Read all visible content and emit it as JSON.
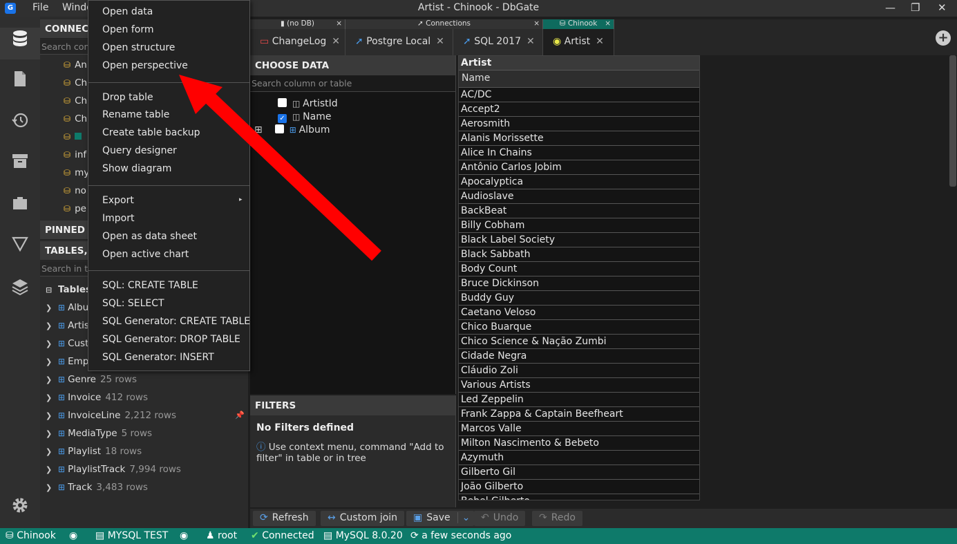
{
  "titlebar": {
    "title": "Artist - Chinook - DbGate",
    "app_icon": "G",
    "menus": [
      "File",
      "Window"
    ]
  },
  "sidebar": {
    "icons": [
      "database-icon",
      "file-icon",
      "history-icon",
      "archive-icon",
      "plugin-icon",
      "filter-icon",
      "layers-icon",
      "settings-icon"
    ]
  },
  "left_panel": {
    "connections_header": "CONNECT",
    "connections_search_placeholder": "Search con",
    "connections": [
      "An",
      "Ch",
      "Ch",
      "Ch",
      "",
      "inf",
      "my",
      "no",
      "pe"
    ],
    "pinned_header": "PINNED",
    "tables_header": "TABLES, V",
    "tables_search_placeholder": "Search in t",
    "tables_group": "Tables",
    "tables": [
      {
        "name": "Albu",
        "rows": ""
      },
      {
        "name": "Artis",
        "rows": ""
      },
      {
        "name": "Cust",
        "rows": ""
      },
      {
        "name": "Emp",
        "rows": ""
      },
      {
        "name": "Genre",
        "rows": "25 rows"
      },
      {
        "name": "Invoice",
        "rows": "412 rows"
      },
      {
        "name": "InvoiceLine",
        "rows": "2,212 rows"
      },
      {
        "name": "MediaType",
        "rows": "5 rows"
      },
      {
        "name": "Playlist",
        "rows": "18 rows"
      },
      {
        "name": "PlaylistTrack",
        "rows": "7,994 rows"
      },
      {
        "name": "Track",
        "rows": "3,483 rows"
      }
    ]
  },
  "tab_groups": [
    {
      "label": "(no DB)",
      "icon": "file-icon"
    },
    {
      "label": "Connections",
      "icon": "plug-icon"
    },
    {
      "label": "Chinook",
      "icon": "database-icon"
    }
  ],
  "tabs": [
    {
      "label": "ChangeLog"
    },
    {
      "label": "Postgre Local"
    },
    {
      "label": "SQL 2017"
    },
    {
      "label": "Artist"
    }
  ],
  "choose_data": {
    "header": "CHOOSE DATA",
    "search_placeholder": "Search column or table",
    "columns": [
      {
        "label": "ArtistId",
        "checked": false
      },
      {
        "label": "Name",
        "checked": true
      },
      {
        "label": "Album",
        "checked": false
      }
    ]
  },
  "filters": {
    "header": "FILTERS",
    "title": "No Filters defined",
    "hint": "Use context menu, command \"Add to filter\" in table or in tree"
  },
  "grid": {
    "table": "Artist",
    "column": "Name",
    "rows": [
      "AC/DC",
      "Accept2",
      "Aerosmith",
      "Alanis Morissette",
      "Alice In Chains",
      "Antônio Carlos Jobim",
      "Apocalyptica",
      "Audioslave",
      "BackBeat",
      "Billy Cobham",
      "Black Label Society",
      "Black Sabbath",
      "Body Count",
      "Bruce Dickinson",
      "Buddy Guy",
      "Caetano Veloso",
      "Chico Buarque",
      "Chico Science & Nação Zumbi",
      "Cidade Negra",
      "Cláudio Zoli",
      "Various Artists",
      "Led Zeppelin",
      "Frank Zappa & Captain Beefheart",
      "Marcos Valle",
      "Milton Nascimento & Bebeto",
      "Azymuth",
      "Gilberto Gil",
      "João Gilberto",
      "Bebel Gilberto"
    ]
  },
  "toolbar": {
    "refresh": "Refresh",
    "custom_join": "Custom join",
    "save": "Save",
    "undo": "Undo",
    "redo": "Redo"
  },
  "statusbar": {
    "db": "Chinook",
    "conn_name": "MYSQL TEST",
    "user": "root",
    "status": "Connected",
    "version": "MySQL 8.0.20",
    "time": "a few seconds ago"
  },
  "context_menu": {
    "group1": [
      "Open data",
      "Open form",
      "Open structure",
      "Open perspective"
    ],
    "group2": [
      "Drop table",
      "Rename table",
      "Create table backup",
      "Query designer",
      "Show diagram"
    ],
    "group3": [
      "Export",
      "Import",
      "Open as data sheet",
      "Open active chart"
    ],
    "group4": [
      "SQL: CREATE TABLE",
      "SQL: SELECT",
      "SQL Generator: CREATE TABLE",
      "SQL Generator: DROP TABLE",
      "SQL Generator: INSERT"
    ]
  },
  "colors": {
    "status": "#0e7a6a",
    "accent": "#1a73e8",
    "arrow": "#ff0000"
  }
}
